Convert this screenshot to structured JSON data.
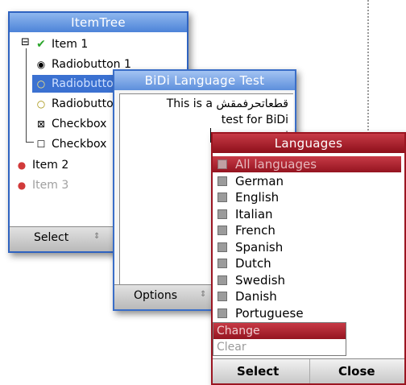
{
  "itemtree": {
    "title": "ItemTree",
    "nodes": [
      {
        "label": "Item 1",
        "icon": "check-icon"
      },
      {
        "label": "Radiobutton 1",
        "icon": "radio-filled-icon"
      },
      {
        "label": "Radiobutto",
        "icon": "radio-empty-icon"
      },
      {
        "label": "Radiobutto",
        "icon": "radio-empty-icon"
      },
      {
        "label": "Checkbox",
        "icon": "checkbox-checked-icon"
      },
      {
        "label": "Checkbox",
        "icon": "checkbox-empty-icon"
      },
      {
        "label": "Item 2",
        "icon": "red-dot-icon"
      },
      {
        "label": "Item 3",
        "icon": "red-dot-icon"
      }
    ],
    "softkey_left": "Select",
    "expander": "⊟",
    "colors": {
      "accent": "#3b71d1",
      "disabled_text": "#a0a0a0",
      "bullet": "#d13a3a"
    }
  },
  "bidi": {
    "title": "BiDi Language Test",
    "lines": [
      "This is a قطعاتحرفمقش",
      "test for BiDi",
      "ا"
    ],
    "softkey_left": "Options"
  },
  "languages": {
    "title": "Languages",
    "items": [
      "All languages",
      "German",
      "English",
      "Italian",
      "French",
      "Spanish",
      "Dutch",
      "Swedish",
      "Danish",
      "Portuguese"
    ],
    "menu": [
      "Change",
      "Clear"
    ],
    "softkey_left": "Select",
    "softkey_right": "Close",
    "colors": {
      "accent": "#9b1521"
    }
  }
}
